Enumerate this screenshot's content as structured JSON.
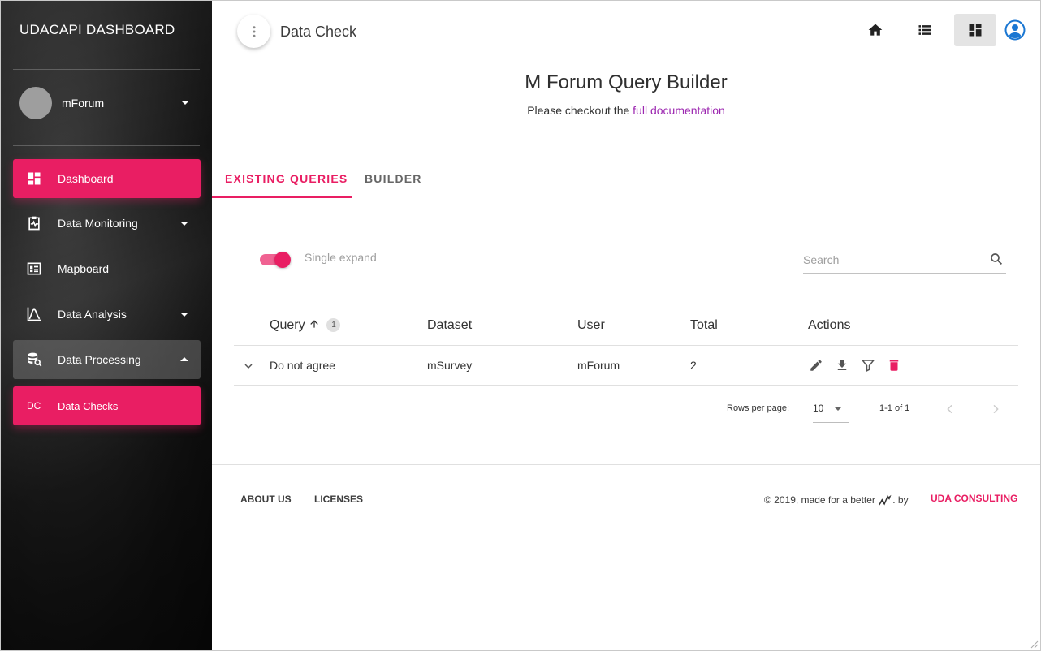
{
  "sidebar": {
    "brand": "UDACAPI DASHBOARD",
    "user_name": "mForum",
    "items": [
      {
        "label": "Dashboard"
      },
      {
        "label": "Data Monitoring"
      },
      {
        "label": "Mapboard"
      },
      {
        "label": "Data Analysis"
      },
      {
        "label": "Data Processing"
      }
    ],
    "sub_item": {
      "abbr": "DC",
      "label": "Data Checks"
    }
  },
  "topbar": {
    "title": "Data Check"
  },
  "page": {
    "heading": "M Forum Query Builder",
    "sub_prefix": "Please checkout the",
    "doc_link": "full documentation"
  },
  "tabs": {
    "existing": "EXISTING QUERIES",
    "builder": "BUILDER"
  },
  "controls": {
    "toggle_label": "Single expand",
    "search_placeholder": "Search"
  },
  "table": {
    "headers": {
      "query": "Query",
      "dataset": "Dataset",
      "user": "User",
      "total": "Total",
      "actions": "Actions"
    },
    "sort_badge": "1",
    "rows": [
      {
        "query": "Do not agree",
        "dataset": "mSurvey",
        "user": "mForum",
        "total": "2"
      }
    ],
    "rows_per_page_label": "Rows per page:",
    "rows_per_page": "10",
    "range": "1-1 of 1"
  },
  "footer": {
    "about": "ABOUT US",
    "licenses": "LICENSES",
    "made": "© 2019, made for a better",
    "by": ". by",
    "company": "UDA CONSULTING"
  },
  "colors": {
    "accent": "#e91e63",
    "link": "#9c27b0",
    "user_icon": "#1976d2"
  }
}
